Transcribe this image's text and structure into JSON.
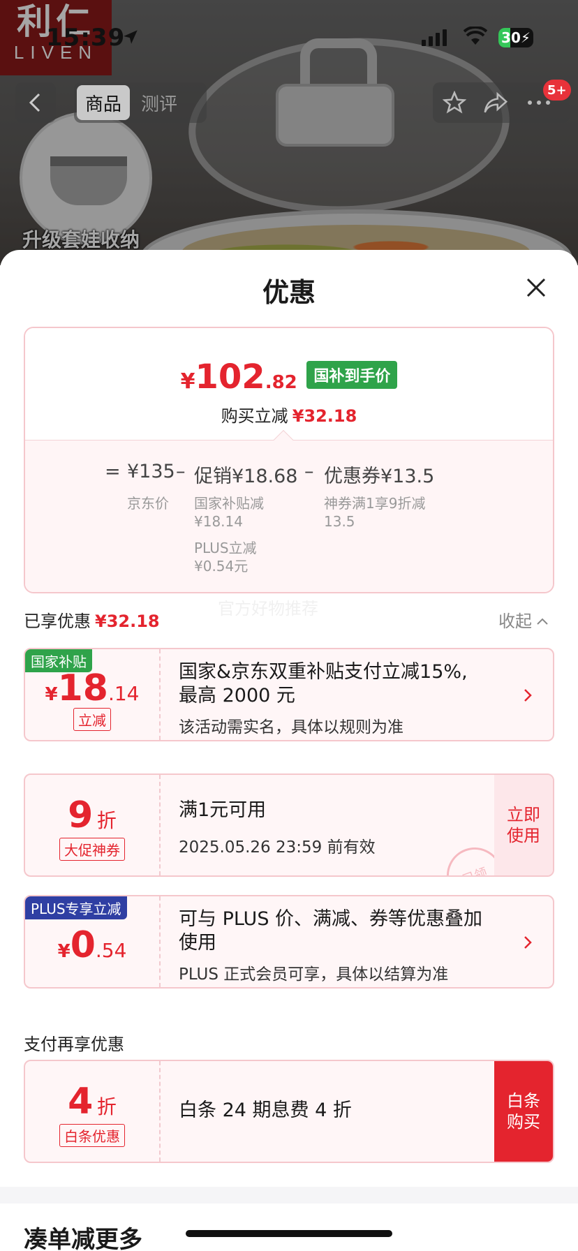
{
  "status_bar": {
    "time": "15:39",
    "battery": "30"
  },
  "brand": {
    "cn": "利仁",
    "en": "LIVEN"
  },
  "product": {
    "caption": "升级套娃收纳"
  },
  "nav": {
    "tabs": [
      {
        "label": "商品",
        "active": true
      },
      {
        "label": "测评",
        "active": false
      }
    ],
    "badge": "5+"
  },
  "sheet": {
    "title": "优惠"
  },
  "summary": {
    "price_yen": "¥",
    "price_int": "102",
    "price_dec": ".82",
    "price_tag": "国补到手价",
    "buy_reduce_label": "购买立减",
    "buy_reduce_amount": "¥32.18",
    "formula": {
      "equals": "=",
      "jd_price": "¥135",
      "jd_label": "京东价",
      "minus1": "–",
      "promo": "促销¥18.68",
      "promo_items": [
        "国家补贴减",
        "¥18.14",
        "PLUS立减",
        "¥0.54元"
      ],
      "minus2": "–",
      "coupon": "优惠券¥13.5",
      "coupon_items": [
        "神券满1享9折减",
        "13.5"
      ]
    }
  },
  "watermark": "官方好物推荐",
  "enjoyed": {
    "label": "已享优惠",
    "amount": "¥32.18",
    "collapse": "收起"
  },
  "coupons": [
    {
      "tag": "国家补贴",
      "yen": "¥",
      "big": "18",
      "small": ".14",
      "sub": "立减",
      "main": [
        "国家&京东双重补贴支付立减15%,",
        "最高 2000 元"
      ],
      "desc": "该活动需实名，具体以规则为准"
    },
    {
      "big": "9",
      "small": "折",
      "sub": "大促神券",
      "main": [
        "满1元可用"
      ],
      "desc": "2025.05.26 23:59 前有效",
      "button": [
        "立即",
        "使用"
      ],
      "stamp": "已领"
    },
    {
      "tag": "PLUS专享立减",
      "yen": "¥",
      "big": "0",
      "small": ".54",
      "main": [
        "可与 PLUS 价、满减、券等优惠叠加",
        "使用"
      ],
      "desc": "PLUS 正式会员可享，具体以结算为准"
    }
  ],
  "pay_more": {
    "label": "支付再享优惠"
  },
  "baitiao": {
    "big": "4",
    "small": "折",
    "sub": "白条优惠",
    "main": "白条 24 期息费 4 折",
    "button": [
      "白条",
      "购买"
    ]
  },
  "more": {
    "title": "凑单减更多"
  },
  "colors": {
    "accent": "#e4242e",
    "gov_green": "#2fa34a",
    "plus_blue": "#2f3fa3"
  }
}
